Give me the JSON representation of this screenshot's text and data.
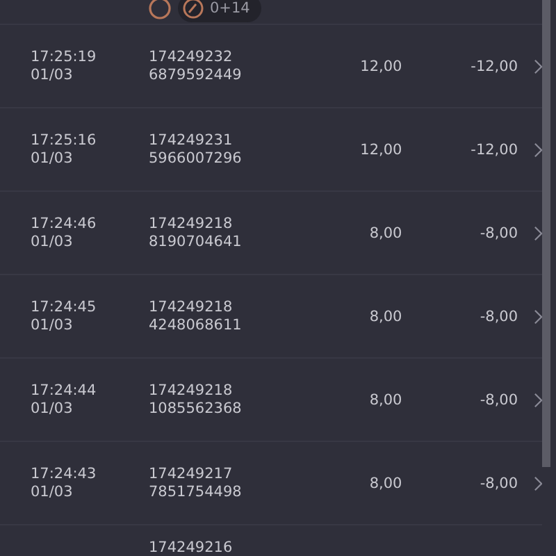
{
  "top_row": {
    "badge": "0+14"
  },
  "rows": [
    {
      "time": "17:25:19",
      "date": "01/03",
      "id_line_1": "174249232",
      "id_line_2": "6879592449",
      "amount": "12,00",
      "balance": "-12,00"
    },
    {
      "time": "17:25:16",
      "date": "01/03",
      "id_line_1": "174249231",
      "id_line_2": "5966007296",
      "amount": "12,00",
      "balance": "-12,00"
    },
    {
      "time": "17:24:46",
      "date": "01/03",
      "id_line_1": "174249218",
      "id_line_2": "8190704641",
      "amount": "8,00",
      "balance": "-8,00"
    },
    {
      "time": "17:24:45",
      "date": "01/03",
      "id_line_1": "174249218",
      "id_line_2": "4248068611",
      "amount": "8,00",
      "balance": "-8,00"
    },
    {
      "time": "17:24:44",
      "date": "01/03",
      "id_line_1": "174249218",
      "id_line_2": "1085562368",
      "amount": "8,00",
      "balance": "-8,00"
    },
    {
      "time": "17:24:43",
      "date": "01/03",
      "id_line_1": "174249217",
      "id_line_2": "7851754498",
      "amount": "8,00",
      "balance": "-8,00"
    },
    {
      "id_line_1": "174249216"
    }
  ]
}
